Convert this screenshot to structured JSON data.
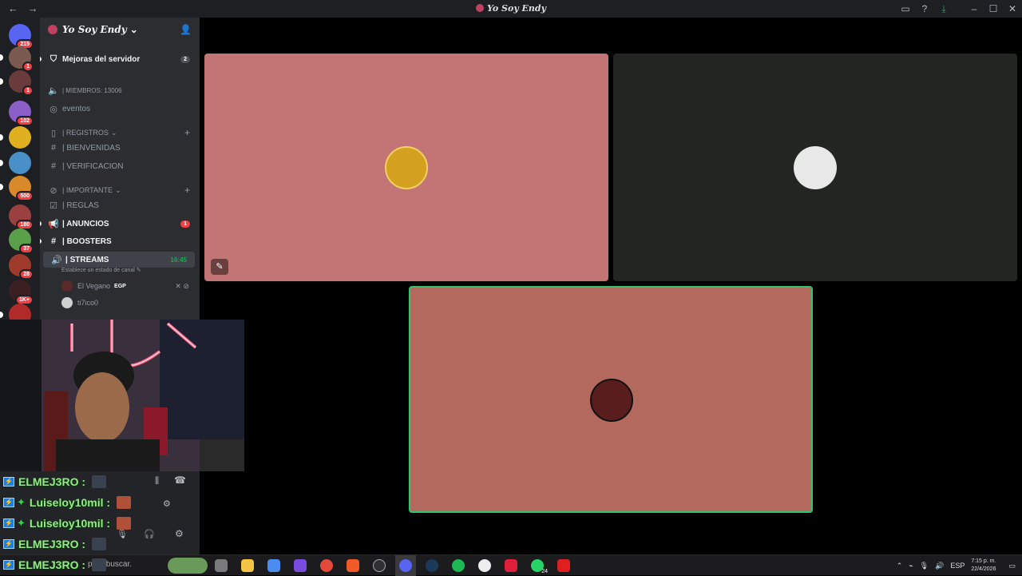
{
  "window": {
    "title": "Yo Soy Endy",
    "back_glyph": "←",
    "forward_glyph": "→",
    "controls": [
      "▭",
      "?",
      "⤓",
      "–",
      "☐",
      "✕"
    ]
  },
  "servers": [
    {
      "badge": "215",
      "color": "#5865f2"
    },
    {
      "badge": "1",
      "color": "#7a5a50"
    },
    {
      "badge": "1",
      "color": "#6a3b3b"
    },
    {
      "badge": "102",
      "color": "#8b5fc8"
    },
    {
      "badge": "",
      "color": "#e0b020"
    },
    {
      "badge": "",
      "color": "#4a90c8"
    },
    {
      "badge": "500",
      "color": "#d88a2a"
    },
    {
      "badge": "180",
      "color": "#9a4040"
    },
    {
      "badge": "37",
      "color": "#5aa04a"
    },
    {
      "badge": "28",
      "color": "#a03a2a"
    },
    {
      "badge": "1K+",
      "color": "#3a2020"
    },
    {
      "badge": "",
      "color": "#b02a2a"
    }
  ],
  "guild": {
    "name": "Yo Soy Endy",
    "chevron": "⌄",
    "invite_icon": "👤"
  },
  "channels": {
    "boost": {
      "label": "Mejoras del servidor",
      "count": "2"
    },
    "members": {
      "label": "| miembros: 13006"
    },
    "events": {
      "label": "eventos"
    },
    "cat_registros": {
      "label": "| registros",
      "chevron": "⌄"
    },
    "bienvenidas": {
      "label": "| BIENVENIDAS"
    },
    "verificacion": {
      "label": "| VERIFICACION"
    },
    "cat_importante": {
      "label": "| importante",
      "chevron": "⌄"
    },
    "reglas": {
      "label": "| REGLAS"
    },
    "anuncios": {
      "label": "| ANUNCIOS",
      "count": "1"
    },
    "boosters": {
      "label": "| BOOSTERS"
    },
    "streams": {
      "label": "| STREAMS",
      "time": "16:45",
      "status": "Establece un estado de canal"
    },
    "voice_users": [
      {
        "name": "El Vegano",
        "tag": "EGP"
      },
      {
        "name": "ti7ico0",
        "tag": ""
      }
    ]
  },
  "chat": [
    {
      "name": "ELMEJ3RO :",
      "star": false,
      "emote": "rocket"
    },
    {
      "name": "Luiseloy10mil :",
      "star": true,
      "emote": "face"
    },
    {
      "name": "Luiseloy10mil :",
      "star": true,
      "emote": "face"
    },
    {
      "name": "ELMEJ3RO :",
      "star": false,
      "emote": "rocket"
    },
    {
      "name": "ELMEJ3RO :",
      "star": false,
      "emote": "rocket"
    }
  ],
  "tiles": [
    {
      "color": "#c27574",
      "avatar": "#d4a020",
      "speaking": false
    },
    {
      "color": "#222522",
      "avatar": "#e8e8e8",
      "speaking": false
    },
    {
      "color": "#b4695f",
      "avatar": "#5a1d1d",
      "speaking": true
    }
  ],
  "taskbar": {
    "search_placeholder": "para buscar.",
    "apps": [
      {
        "name": "task-view",
        "color": "#7a7a7a",
        "count": ""
      },
      {
        "name": "file-explorer",
        "color": "#f4c542",
        "count": ""
      },
      {
        "name": "store",
        "color": "#4a8cf0",
        "count": ""
      },
      {
        "name": "app-purple",
        "color": "#7b4be0",
        "count": ""
      },
      {
        "name": "chrome",
        "color": "#e44a3a",
        "count": ""
      },
      {
        "name": "brave",
        "color": "#f05a28",
        "count": ""
      },
      {
        "name": "obs",
        "color": "#303030",
        "count": ""
      },
      {
        "name": "discord",
        "color": "#5865f2",
        "count": ""
      },
      {
        "name": "steam",
        "color": "#1b3a5a",
        "count": ""
      },
      {
        "name": "spotify",
        "color": "#1db954",
        "count": ""
      },
      {
        "name": "app-white",
        "color": "#eeeeee",
        "count": ""
      },
      {
        "name": "app-red",
        "color": "#e0203a",
        "count": ""
      },
      {
        "name": "whatsapp",
        "color": "#25d366",
        "count": "24"
      },
      {
        "name": "youtube",
        "color": "#e02020",
        "count": ""
      }
    ],
    "lang": "ESP",
    "time": "7:15 p. m.",
    "date": "22/4/2026"
  }
}
